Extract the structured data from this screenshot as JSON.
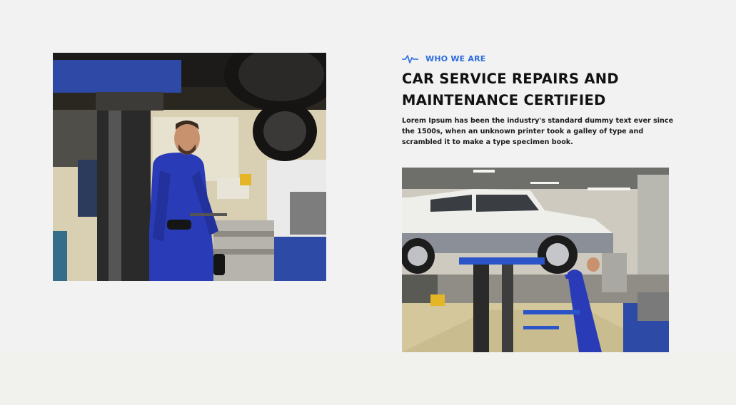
{
  "about": {
    "eyebrow_icon": "heartbeat-pulse-icon",
    "eyebrow": "WHO WE ARE",
    "heading_lines": [
      "CAR SERVICE REPAIRS AND",
      "MAINTENANCE CERTIFIED"
    ],
    "body_lines": [
      "Lorem Ipsum has been the industry's standard dummy text ever since",
      "the 1500s, when an unknown printer took a galley of type and",
      "scrambled it to make a type specimen book."
    ]
  },
  "images": {
    "left": "photo-mechanic-under-lifted-car",
    "right": "photo-suv-on-lift-in-garage"
  },
  "colors": {
    "accent": "#2d6be0",
    "heading": "#111111",
    "background": "#f2f2f2"
  }
}
